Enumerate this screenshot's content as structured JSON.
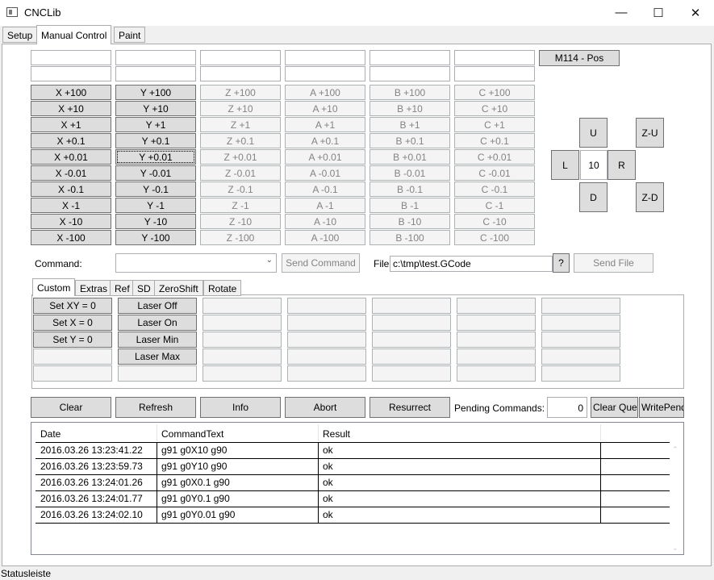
{
  "window": {
    "title": "CNCLib",
    "minimize": "—",
    "maximize": "☐",
    "close": "✕"
  },
  "main_tabs": [
    "Setup",
    "Manual Control",
    "Paint"
  ],
  "axis_buttons": {
    "X": [
      "X +100",
      "X +10",
      "X +1",
      "X +0.1",
      "X +0.01",
      "X -0.01",
      "X -0.1",
      "X -1",
      "X -10",
      "X -100"
    ],
    "Y": [
      "Y +100",
      "Y +10",
      "Y +1",
      "Y +0.1",
      "Y +0.01",
      "Y -0.01",
      "Y -0.1",
      "Y -1",
      "Y -10",
      "Y -100"
    ],
    "Z": [
      "Z +100",
      "Z +10",
      "Z +1",
      "Z +0.1",
      "Z +0.01",
      "Z -0.01",
      "Z -0.1",
      "Z -1",
      "Z -10",
      "Z -100"
    ],
    "A": [
      "A +100",
      "A +10",
      "A +1",
      "A +0.1",
      "A +0.01",
      "A -0.01",
      "A -0.1",
      "A -1",
      "A -10",
      "A -100"
    ],
    "B": [
      "B +100",
      "B +10",
      "B +1",
      "B +0.1",
      "B +0.01",
      "B -0.01",
      "B -0.1",
      "B -1",
      "B -10",
      "B -100"
    ],
    "C": [
      "C +100",
      "C +10",
      "C +1",
      "C +0.1",
      "C +0.01",
      "C -0.01",
      "C -0.1",
      "C -1",
      "C -10",
      "C -100"
    ]
  },
  "m114_label": "M114 - Pos",
  "jog": {
    "up": "U",
    "left": "L",
    "step": "10",
    "right": "R",
    "down": "D",
    "z_up": "Z-U",
    "z_down": "Z-D"
  },
  "command": {
    "label": "Command:",
    "value": "",
    "send_label": "Send Command"
  },
  "file": {
    "label": "File",
    "path": "c:\\tmp\\test.GCode",
    "browse_label": "?",
    "send_label": "Send File"
  },
  "sub_tabs": [
    "Custom",
    "Extras",
    "Ref",
    "SD",
    "ZeroShift",
    "Rotate"
  ],
  "custom_buttons": {
    "col1": [
      "Set XY = 0",
      "Set X = 0",
      "Set Y = 0"
    ],
    "col2": [
      "Laser Off",
      "Laser On",
      "Laser Min",
      "Laser Max"
    ]
  },
  "actions": {
    "clear": "Clear",
    "refresh": "Refresh",
    "info": "Info",
    "abort": "Abort",
    "resurrect": "Resurrect",
    "pending_label": "Pending Commands:",
    "pending_value": "0",
    "clear_queue": "Clear Queue",
    "write_pending": "WritePending"
  },
  "log_table": {
    "columns": [
      "Date",
      "CommandText",
      "Result"
    ],
    "rows": [
      [
        "2016.03.26 13:23:41.22",
        "g91 g0X10 g90",
        "ok"
      ],
      [
        "2016.03.26 13:23:59.73",
        "g91 g0Y10 g90",
        "ok"
      ],
      [
        "2016.03.26 13:24:01.26",
        "g91 g0X0.1 g90",
        "ok"
      ],
      [
        "2016.03.26 13:24:01.77",
        "g91 g0Y0.1 g90",
        "ok"
      ],
      [
        "2016.03.26 13:24:02.10",
        "g91 g0Y0.01 g90",
        "ok"
      ]
    ]
  },
  "status": "Statusleiste"
}
